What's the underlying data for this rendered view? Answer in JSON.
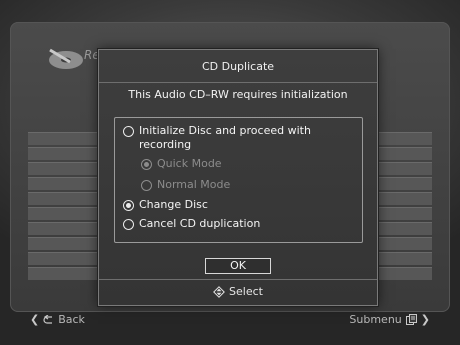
{
  "background": {
    "title": "Rec"
  },
  "dialog": {
    "title": "CD Duplicate",
    "message": "This Audio CD–RW requires initialization",
    "options": [
      {
        "label": "Initialize Disc and proceed with recording",
        "selected": false,
        "enabled": true
      },
      {
        "label": "Quick Mode",
        "selected": true,
        "enabled": false
      },
      {
        "label": "Normal Mode",
        "selected": false,
        "enabled": false
      },
      {
        "label": "Change Disc",
        "selected": true,
        "enabled": true
      },
      {
        "label": "Cancel CD duplication",
        "selected": false,
        "enabled": true
      }
    ],
    "ok_label": "OK",
    "select_label": "Select",
    "select_icon": "up-down-arrows-icon"
  },
  "footer": {
    "back_label": "Back",
    "back_icon": "return-icon",
    "submenu_label": "Submenu",
    "submenu_icon": "submenu-icon"
  },
  "colors": {
    "dialog_bg": "#383838",
    "text": "#f2f2f2",
    "disabled_text": "#8c8c8c"
  }
}
